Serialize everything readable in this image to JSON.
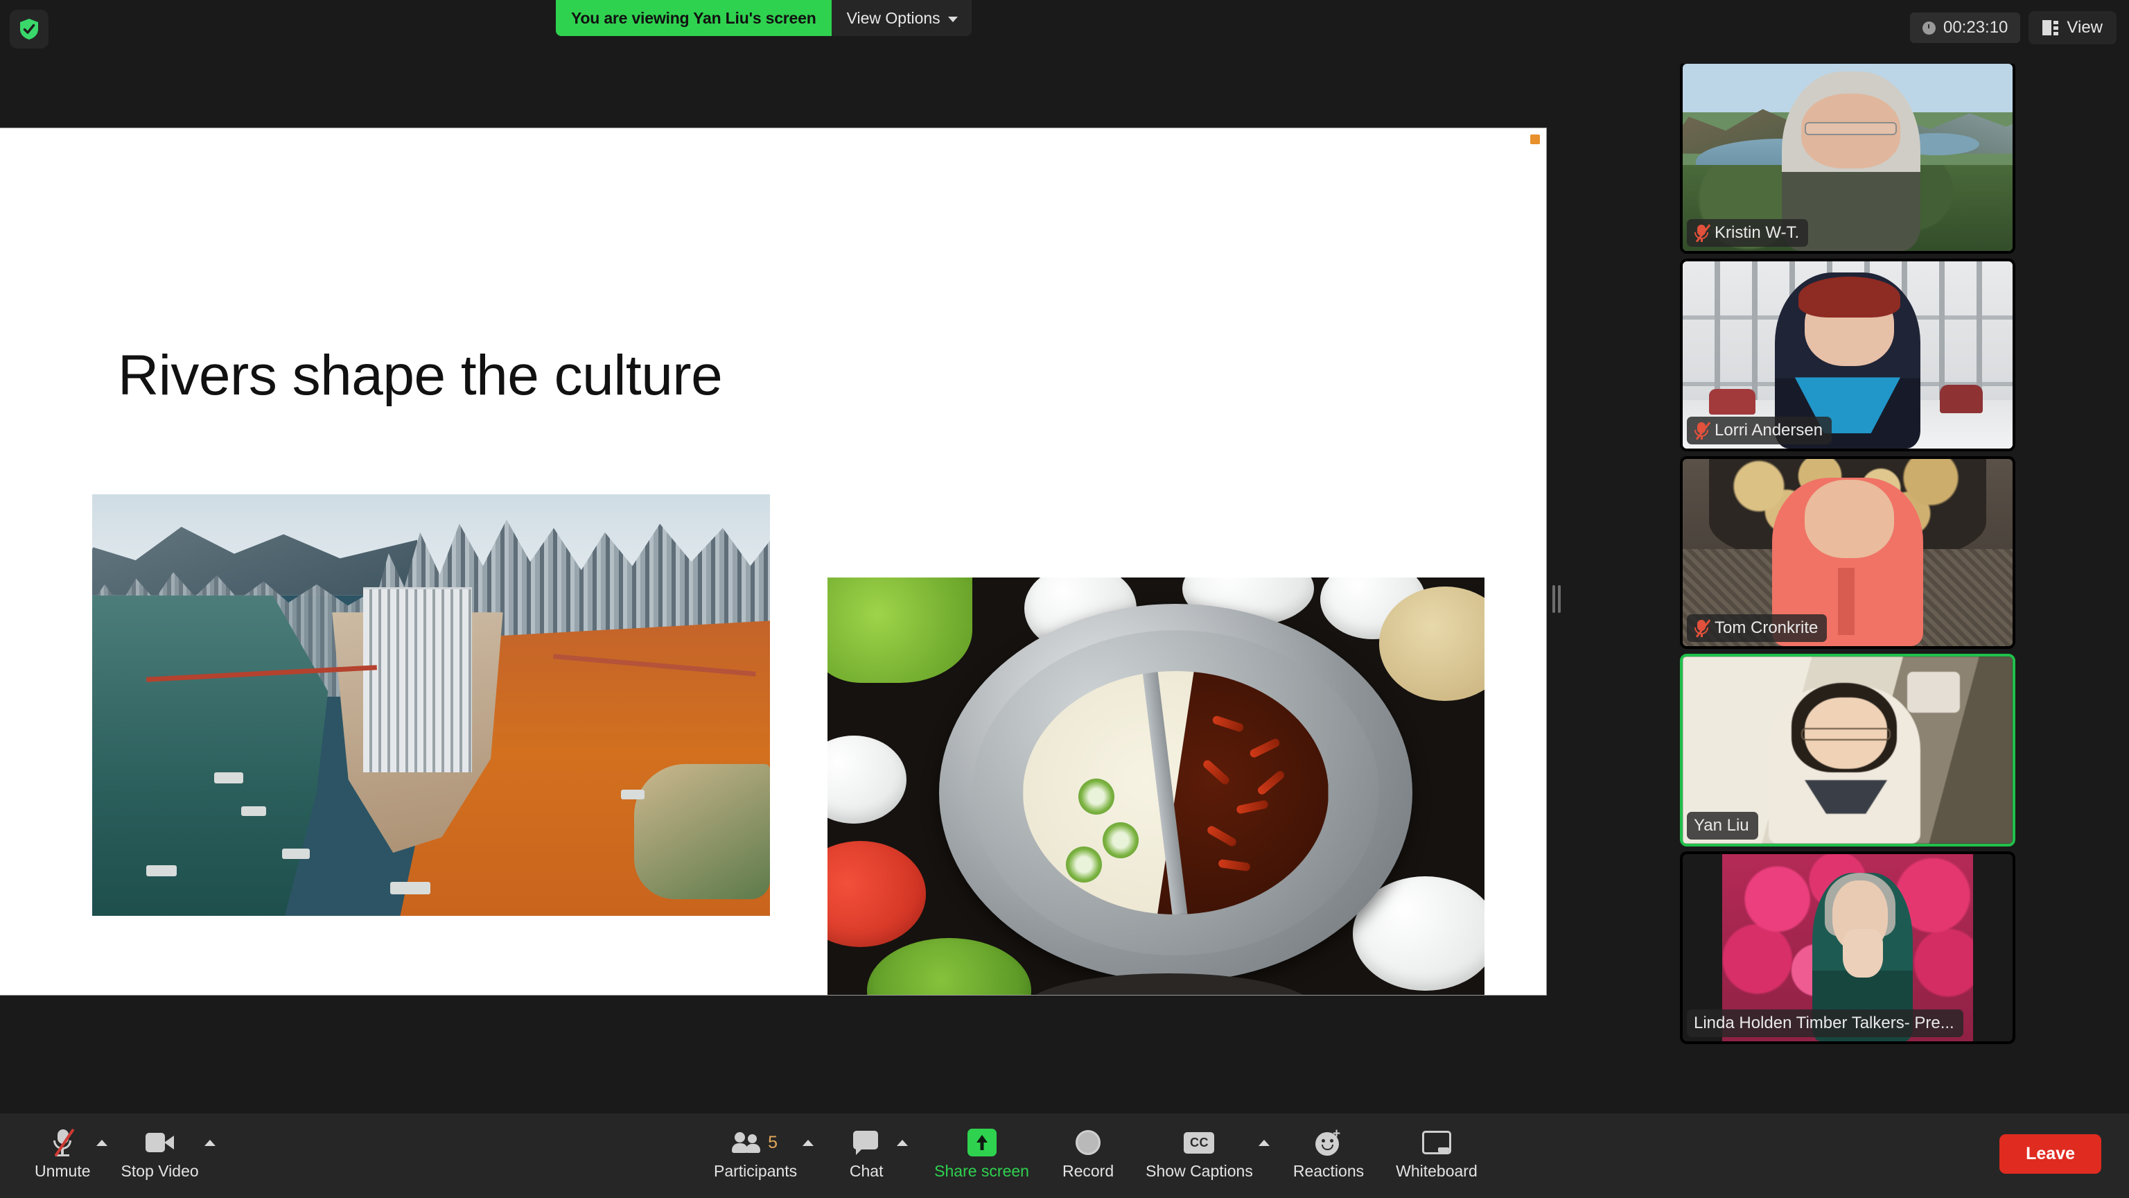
{
  "topbar": {
    "security_icon": "shield-check-icon",
    "viewing_banner": "You are viewing Yan Liu's screen",
    "view_options_label": "View Options",
    "view_options_icon": "chevron-down-icon",
    "timer_icon": "clock-icon",
    "timer": "00:23:10",
    "view_icon": "layout-icon",
    "view_label": "View"
  },
  "shared_screen": {
    "slide": {
      "title": "Rivers shape the culture",
      "images": [
        {
          "name": "chongqing-river-confluence-photo",
          "alt": "Aerial view of a city at the confluence of a green river and a muddy orange river with bridges and high-rise towers"
        },
        {
          "name": "chinese-hotpot-photo",
          "alt": "Split yin-yang hotpot with clear broth and spicy chili broth surrounded by side dishes"
        }
      ],
      "marker_color": "#e8902b"
    },
    "resize_handle": "share-resize-handle"
  },
  "participants": [
    {
      "name": "Kristin W-T.",
      "muted": true,
      "active_speaker": false
    },
    {
      "name": "Lorri Andersen",
      "muted": true,
      "active_speaker": false
    },
    {
      "name": "Tom Cronkrite",
      "muted": true,
      "active_speaker": false
    },
    {
      "name": "Yan Liu",
      "muted": false,
      "active_speaker": true
    },
    {
      "name": "Linda Holden Timber Talkers- Pre...",
      "muted": false,
      "active_speaker": false
    }
  ],
  "toolbar": {
    "mic": {
      "label": "Unmute",
      "icon": "microphone-muted-icon",
      "has_menu": true
    },
    "video": {
      "label": "Stop Video",
      "icon": "camera-icon",
      "has_menu": true
    },
    "participants": {
      "label": "Participants",
      "icon": "people-icon",
      "count": "5",
      "has_menu": true
    },
    "chat": {
      "label": "Chat",
      "icon": "chat-bubble-icon",
      "has_menu": true
    },
    "share": {
      "label": "Share screen",
      "icon": "share-screen-icon",
      "active": true
    },
    "record": {
      "label": "Record",
      "icon": "record-circle-icon"
    },
    "captions": {
      "label": "Show Captions",
      "icon": "closed-captions-icon",
      "has_menu": true
    },
    "reactions": {
      "label": "Reactions",
      "icon": "smiley-plus-icon"
    },
    "whiteboard": {
      "label": "Whiteboard",
      "icon": "whiteboard-icon"
    },
    "leave": {
      "label": "Leave"
    }
  },
  "colors": {
    "accent_green": "#2fd24f",
    "active_border": "#21c04b",
    "leave_red": "#e02b20",
    "toolbar_bg": "#262626",
    "app_bg": "#1a1a1a"
  }
}
